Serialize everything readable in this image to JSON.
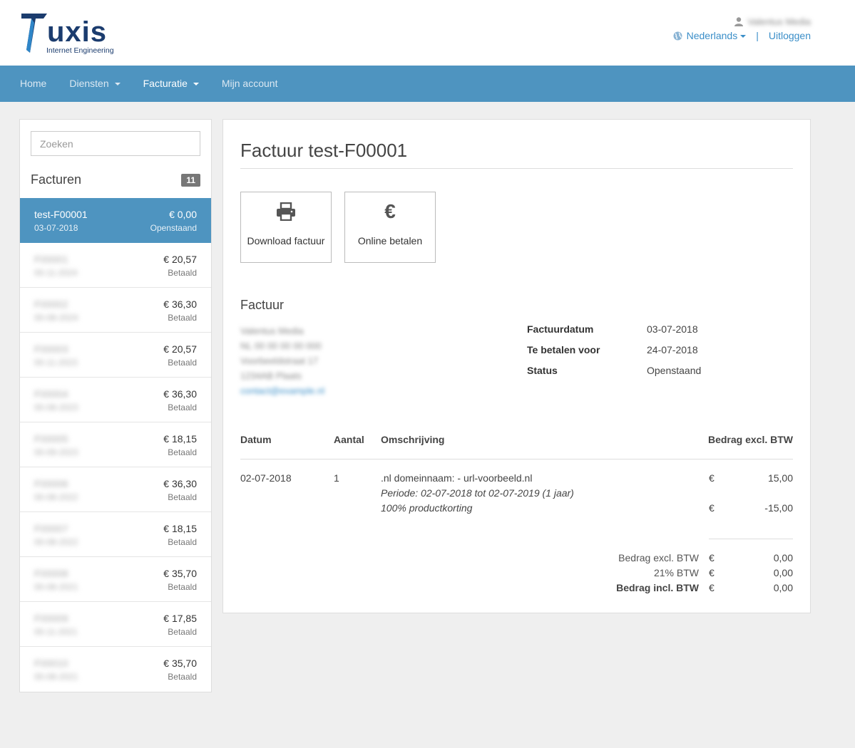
{
  "header": {
    "logo_text": "Tuxis",
    "logo_sub": "Internet Engineering",
    "user_name": "Valentus Media",
    "language": "Nederlands",
    "logout": "Uitloggen",
    "separator": "|"
  },
  "nav": {
    "items": [
      {
        "label": "Home"
      },
      {
        "label": "Diensten"
      },
      {
        "label": "Facturatie"
      },
      {
        "label": "Mijn account"
      }
    ]
  },
  "sidebar": {
    "search_placeholder": "Zoeken",
    "title": "Facturen",
    "count": "11",
    "invoices": [
      {
        "id": "test-F00001",
        "date": "03-07-2018",
        "amount": "€ 0,00",
        "status": "Openstaand"
      },
      {
        "id": "F00001",
        "date": "00-11-2024",
        "amount": "€ 20,57",
        "status": "Betaald"
      },
      {
        "id": "F00002",
        "date": "00-08-2024",
        "amount": "€ 36,30",
        "status": "Betaald"
      },
      {
        "id": "F00003",
        "date": "00-11-2023",
        "amount": "€ 20,57",
        "status": "Betaald"
      },
      {
        "id": "F00004",
        "date": "00-08-2023",
        "amount": "€ 36,30",
        "status": "Betaald"
      },
      {
        "id": "F00005",
        "date": "00-09-2023",
        "amount": "€ 18,15",
        "status": "Betaald"
      },
      {
        "id": "F00006",
        "date": "00-08-2022",
        "amount": "€ 36,30",
        "status": "Betaald"
      },
      {
        "id": "F00007",
        "date": "00-08-2022",
        "amount": "€ 18,15",
        "status": "Betaald"
      },
      {
        "id": "F00008",
        "date": "00-08-2021",
        "amount": "€ 35,70",
        "status": "Betaald"
      },
      {
        "id": "F00009",
        "date": "00-11-2021",
        "amount": "€ 17,85",
        "status": "Betaald"
      },
      {
        "id": "F00010",
        "date": "00-08-2021",
        "amount": "€ 35,70",
        "status": "Betaald"
      }
    ]
  },
  "main": {
    "title": "Factuur test-F00001",
    "buttons": {
      "download": "Download factuur",
      "pay": "Online betalen",
      "pay_icon": "€"
    },
    "section_title": "Factuur",
    "address": {
      "line1": "Valentus Media",
      "line2": "NL 00 00 00 00 000",
      "line3": "Voorbeeldstraat 17",
      "line4": "1234AB Plaats",
      "email": "contact@example.nl"
    },
    "meta": [
      {
        "key": "Factuurdatum",
        "value": "03-07-2018"
      },
      {
        "key": "Te betalen voor",
        "value": "24-07-2018"
      },
      {
        "key": "Status",
        "value": "Openstaand"
      }
    ],
    "table": {
      "headers": {
        "date": "Datum",
        "qty": "Aantal",
        "desc": "Omschrijving",
        "amount": "Bedrag excl. BTW"
      },
      "row": {
        "date": "02-07-2018",
        "qty": "1",
        "desc": ".nl domeinnaam: - url-voorbeeld.nl",
        "period": "Periode: 02-07-2018 tot 02-07-2019 (1 jaar)",
        "discount": "100% productkorting",
        "amount": "15,00",
        "discount_amount": "-15,00"
      },
      "currency": "€"
    },
    "totals": [
      {
        "label": "Bedrag excl. BTW",
        "value": "0,00"
      },
      {
        "label": "21% BTW",
        "value": "0,00"
      },
      {
        "label": "Bedrag incl. BTW",
        "value": "0,00"
      }
    ]
  }
}
